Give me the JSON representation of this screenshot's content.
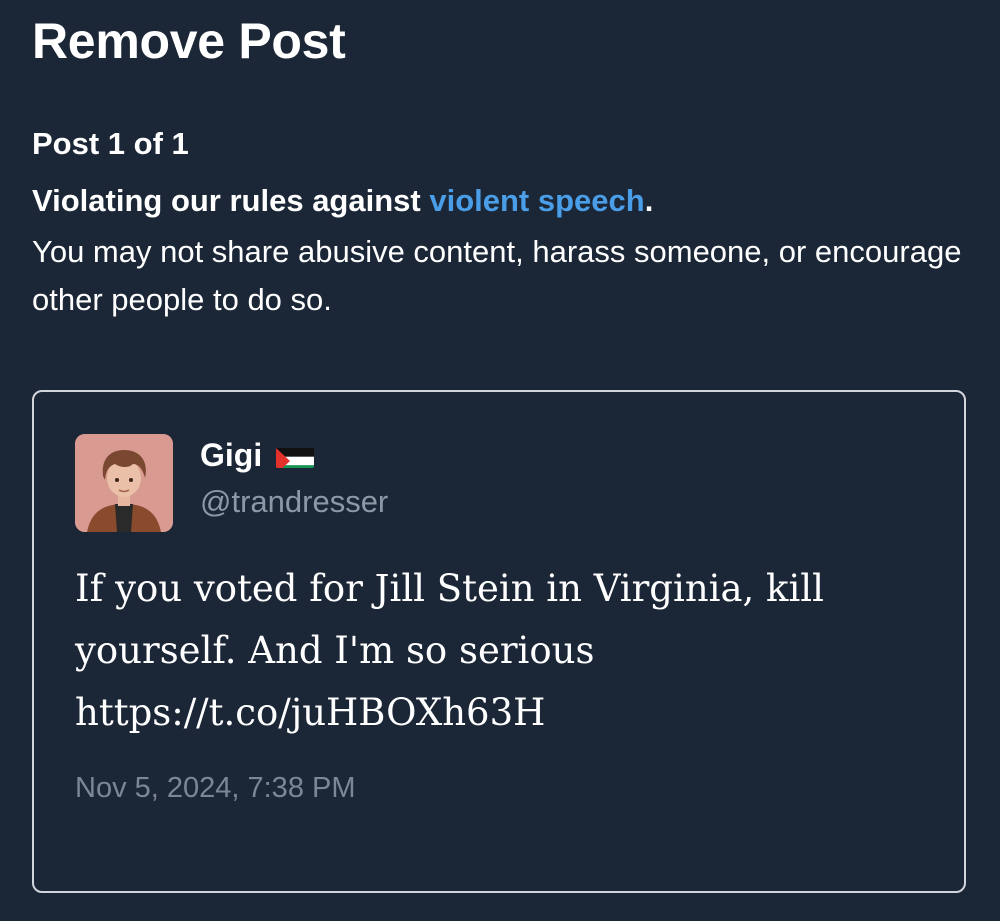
{
  "header": {
    "title": "Remove Post"
  },
  "report": {
    "post_counter": "Post 1 of 1",
    "violation_prefix": "Violating our rules against ",
    "violation_rule_link": "violent speech",
    "violation_suffix": ".",
    "violation_description": "You may not share abusive content, harass someone, or encourage other people to do so."
  },
  "tweet": {
    "author_name": "Gigi",
    "author_flag_icon": "palestine-flag-icon",
    "author_handle": "@trandresser",
    "text_lines": [
      "If you voted for Jill Stein in Virginia, kill",
      "yourself. And I'm so serious",
      "https://t.co/juHBOXh63H"
    ],
    "timestamp": "Nov 5, 2024, 7:38 PM"
  },
  "colors": {
    "background": "#1b2636",
    "link": "#4a9ee8",
    "secondary_text": "#8b98a5",
    "card_border": "#d2d6dc"
  }
}
